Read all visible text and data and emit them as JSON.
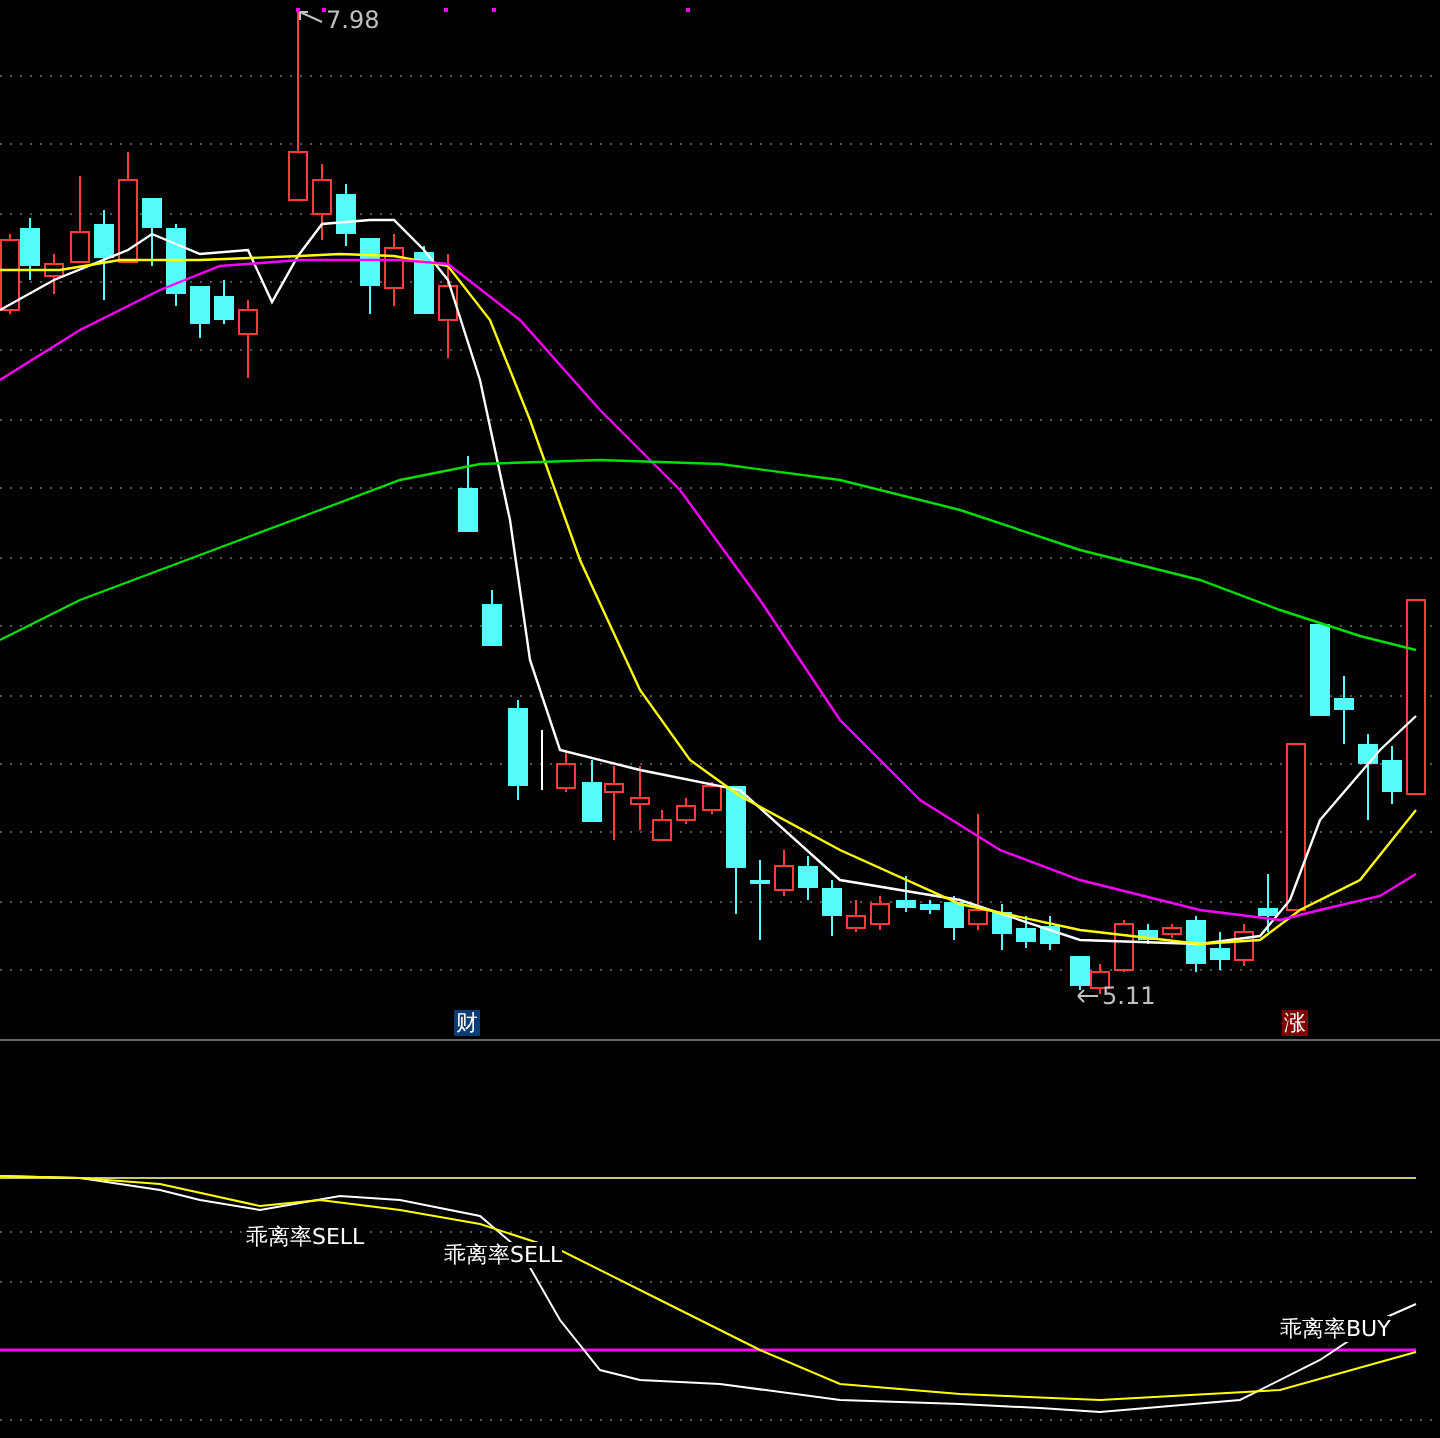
{
  "price_panel": {
    "high_label": "7.98",
    "low_label": "5.11",
    "event_markers": [
      {
        "text": "财",
        "kind": "finance"
      },
      {
        "text": "涨",
        "kind": "limit-up"
      }
    ]
  },
  "indicator_panel": {
    "signals": [
      {
        "text": "乖离率SELL"
      },
      {
        "text": "乖离率SELL"
      },
      {
        "text": "乖离率BUY"
      }
    ]
  }
}
